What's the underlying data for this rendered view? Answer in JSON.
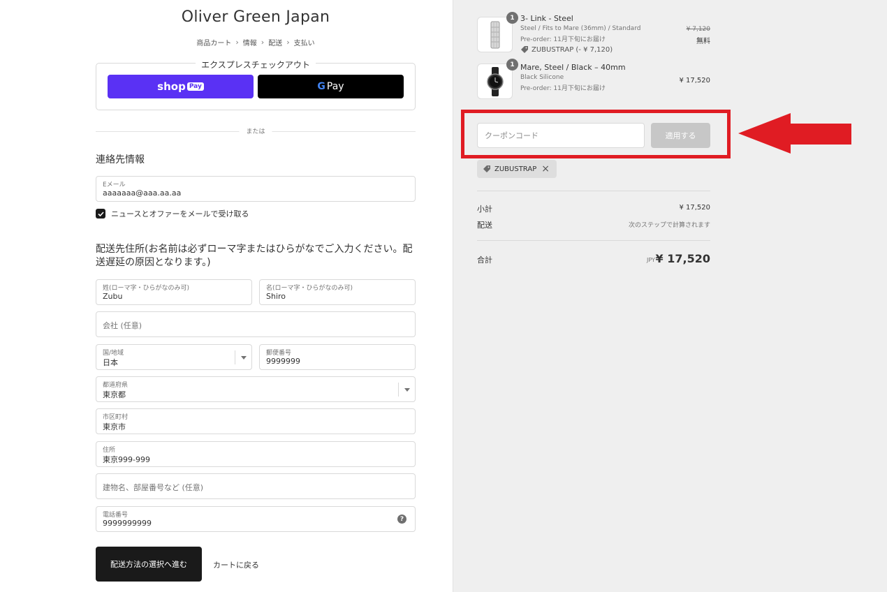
{
  "shop": {
    "title": "Oliver Green Japan"
  },
  "breadcrumb": [
    {
      "label": "商品カート"
    },
    {
      "label": "情報"
    },
    {
      "label": "配送"
    },
    {
      "label": "支払い"
    }
  ],
  "express": {
    "label": "エクスプレスチェックアウト",
    "shoppay_text": "shop",
    "shoppay_tag": "Pay",
    "gpay_g": "G",
    "gpay_text": "Pay"
  },
  "divider": {
    "or_label": "または"
  },
  "contact": {
    "title": "連絡先情報",
    "email_label": "Eメール",
    "email_value": "aaaaaaa@aaa.aa.aa",
    "newsletter_label": "ニュースとオファーをメールで受け取る",
    "newsletter_checked": true
  },
  "shipping": {
    "title": "配送先住所(お名前は必ずローマ字またはひらがなでご入力ください。配送遅延の原因となります。)",
    "last_name": {
      "label": "姓(ローマ字・ひらがなのみ可)",
      "value": "Zubu"
    },
    "first_name": {
      "label": "名(ローマ字・ひらがなのみ可)",
      "value": "Shiro"
    },
    "company": {
      "placeholder": "会社 (任意)"
    },
    "country": {
      "label": "国/地域",
      "value": "日本"
    },
    "postal": {
      "label": "郵便番号",
      "value": "9999999"
    },
    "prefecture": {
      "label": "都道府県",
      "value": "東京都"
    },
    "city": {
      "label": "市区町村",
      "value": "東京市"
    },
    "address": {
      "label": "住所",
      "value": "東京999-999"
    },
    "building": {
      "placeholder": "建物名、部屋番号など (任意)"
    },
    "phone": {
      "label": "電話番号",
      "value": "9999999999",
      "help": "?"
    }
  },
  "actions": {
    "continue_label": "配送方法の選択へ進む",
    "back_label": "カートに戻る"
  },
  "order": {
    "items": [
      {
        "quantity": "1",
        "name": "3- Link - Steel",
        "variant": "Steel / Fits to Mare (36mm) / Standard",
        "note": "Pre-order: 11月下旬にお届け",
        "discount": "ZUBUSTRAP (- ¥ 7,120)",
        "original_price": "¥ 7,120",
        "price": "無料"
      },
      {
        "quantity": "1",
        "name": "Mare, Steel / Black – 40mm",
        "variant": "Black Silicone",
        "note": "Pre-order: 11月下旬にお届け",
        "price": "¥ 17,520"
      }
    ],
    "coupon": {
      "placeholder": "クーポンコード",
      "apply_label": "適用する",
      "applied_code": "ZUBUSTRAP"
    },
    "subtotal_label": "小計",
    "subtotal_value": "¥ 17,520",
    "shipping_label": "配送",
    "shipping_value": "次のステップで計算されます",
    "total_label": "合計",
    "total_currency": "JPY",
    "total_value": "¥ 17,520"
  },
  "colors": {
    "shoppay": "#5a31f4",
    "highlight": "#e01c23",
    "sidebar_bg": "#efefef"
  }
}
